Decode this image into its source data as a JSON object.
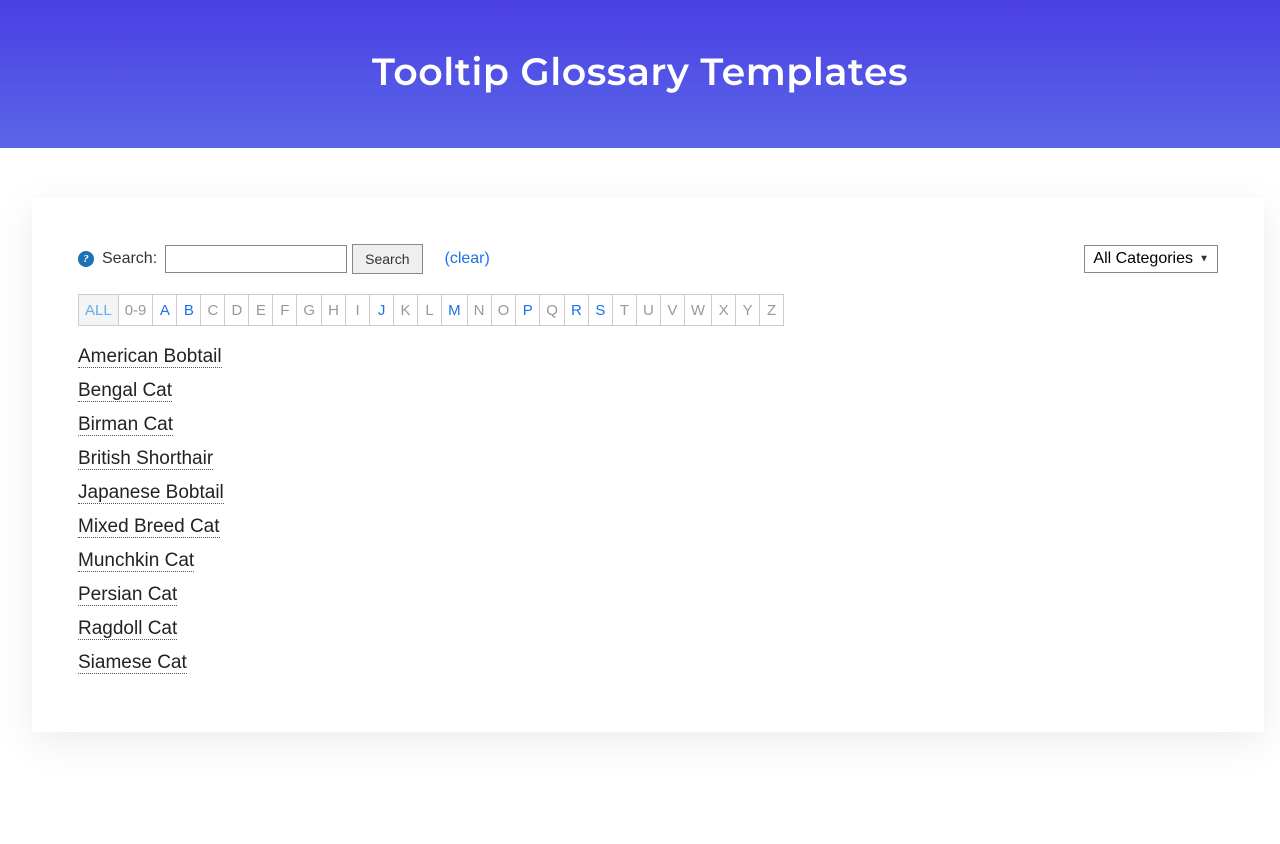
{
  "hero": {
    "title": "Tooltip Glossary Templates"
  },
  "search": {
    "label": "Search:",
    "button": "Search",
    "clear": "(clear)",
    "placeholder": ""
  },
  "categories": {
    "selected": "All Categories"
  },
  "alpha": [
    {
      "label": "ALL",
      "state": "active"
    },
    {
      "label": "0-9",
      "state": ""
    },
    {
      "label": "A",
      "state": "has-items"
    },
    {
      "label": "B",
      "state": "has-items"
    },
    {
      "label": "C",
      "state": ""
    },
    {
      "label": "D",
      "state": ""
    },
    {
      "label": "E",
      "state": ""
    },
    {
      "label": "F",
      "state": ""
    },
    {
      "label": "G",
      "state": ""
    },
    {
      "label": "H",
      "state": ""
    },
    {
      "label": "I",
      "state": ""
    },
    {
      "label": "J",
      "state": "has-items"
    },
    {
      "label": "K",
      "state": ""
    },
    {
      "label": "L",
      "state": ""
    },
    {
      "label": "M",
      "state": "has-items"
    },
    {
      "label": "N",
      "state": ""
    },
    {
      "label": "O",
      "state": ""
    },
    {
      "label": "P",
      "state": "has-items"
    },
    {
      "label": "Q",
      "state": ""
    },
    {
      "label": "R",
      "state": "has-items"
    },
    {
      "label": "S",
      "state": "has-items"
    },
    {
      "label": "T",
      "state": ""
    },
    {
      "label": "U",
      "state": ""
    },
    {
      "label": "V",
      "state": ""
    },
    {
      "label": "W",
      "state": ""
    },
    {
      "label": "X",
      "state": ""
    },
    {
      "label": "Y",
      "state": ""
    },
    {
      "label": "Z",
      "state": ""
    }
  ],
  "terms": [
    "American Bobtail",
    "Bengal Cat",
    "Birman Cat",
    "British Shorthair",
    "Japanese Bobtail",
    "Mixed Breed Cat",
    "Munchkin Cat",
    "Persian Cat",
    "Ragdoll Cat",
    "Siamese Cat"
  ]
}
